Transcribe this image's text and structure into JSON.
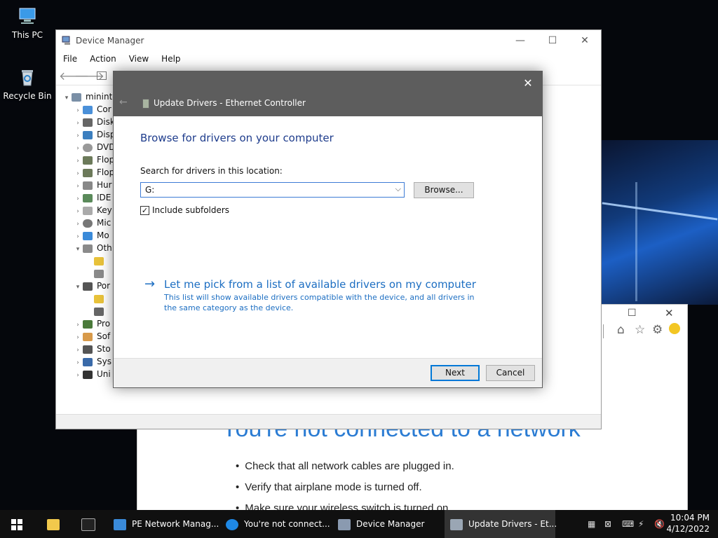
{
  "desktop": {
    "icons": [
      {
        "label": "This PC",
        "icon": "this-pc-icon"
      },
      {
        "label": "Recycle Bin",
        "icon": "recycle-bin-icon"
      }
    ]
  },
  "ie_window": {
    "heading": "You're not connected to a network",
    "items": [
      "Check that all network cables are plugged in.",
      "Verify that airplane mode is turned off.",
      "Make sure your wireless switch is turned on."
    ]
  },
  "device_manager": {
    "title": "Device Manager",
    "menu": [
      "File",
      "Action",
      "View",
      "Help"
    ],
    "tree": [
      {
        "label": "minint-",
        "expanded": true,
        "level": 0
      },
      {
        "label": "Cor",
        "level": 1
      },
      {
        "label": "Disk",
        "level": 1
      },
      {
        "label": "Disp",
        "level": 1
      },
      {
        "label": "DVD",
        "level": 1
      },
      {
        "label": "Flop",
        "level": 1
      },
      {
        "label": "Flop",
        "level": 1
      },
      {
        "label": "Hur",
        "level": 1
      },
      {
        "label": "IDE",
        "level": 1
      },
      {
        "label": "Key",
        "level": 1
      },
      {
        "label": "Mic",
        "level": 1
      },
      {
        "label": "Mo",
        "level": 1
      },
      {
        "label": "Oth",
        "level": 1,
        "expanded": true
      },
      {
        "label": "",
        "level": 2
      },
      {
        "label": "",
        "level": 2
      },
      {
        "label": "Por",
        "level": 1,
        "expanded": true
      },
      {
        "label": "",
        "level": 2
      },
      {
        "label": "",
        "level": 2
      },
      {
        "label": "Pro",
        "level": 1
      },
      {
        "label": "Sof",
        "level": 1
      },
      {
        "label": "Sto",
        "level": 1
      },
      {
        "label": "Sys",
        "level": 1
      },
      {
        "label": "Uni",
        "level": 1
      }
    ]
  },
  "dialog": {
    "title": "Update Drivers - Ethernet Controller",
    "heading": "Browse for drivers on your computer",
    "search_label": "Search for drivers in this location:",
    "path_value": "G:",
    "browse_label": "Browse...",
    "include_subfolders_label": "Include subfolders",
    "include_subfolders_checked": true,
    "pick_link": "Let me pick from a list of available drivers on my computer",
    "pick_desc": "This list will show available drivers compatible with the device, and all drivers in the same category as the device.",
    "next_label": "Next",
    "cancel_label": "Cancel"
  },
  "taskbar": {
    "items": [
      {
        "label": "PE Network Manag...",
        "icon": "network-manager-icon"
      },
      {
        "label": "You're not connect...",
        "icon": "ie-icon"
      },
      {
        "label": "Device Manager",
        "icon": "device-manager-icon"
      },
      {
        "label": "Update Drivers - Et...",
        "icon": "update-drivers-icon"
      }
    ],
    "time": "10:04 PM",
    "date": "4/12/2022"
  },
  "colors": {
    "accent": "#0078d7",
    "link": "#1c6ec2",
    "heading": "#1e3c8c",
    "ie_heading": "#2b7cd3"
  }
}
